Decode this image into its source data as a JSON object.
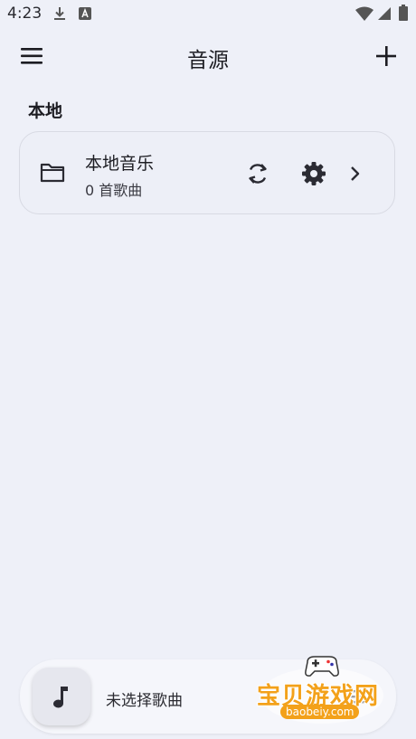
{
  "status_bar": {
    "time": "4:23"
  },
  "app_bar": {
    "title": "音源"
  },
  "section": {
    "title": "本地"
  },
  "local_source": {
    "name": "本地音乐",
    "count": "0 首歌曲"
  },
  "player": {
    "now_playing": "未选择歌曲"
  },
  "watermark": {
    "text": "宝贝游戏网",
    "url": "baobeiy.com"
  }
}
